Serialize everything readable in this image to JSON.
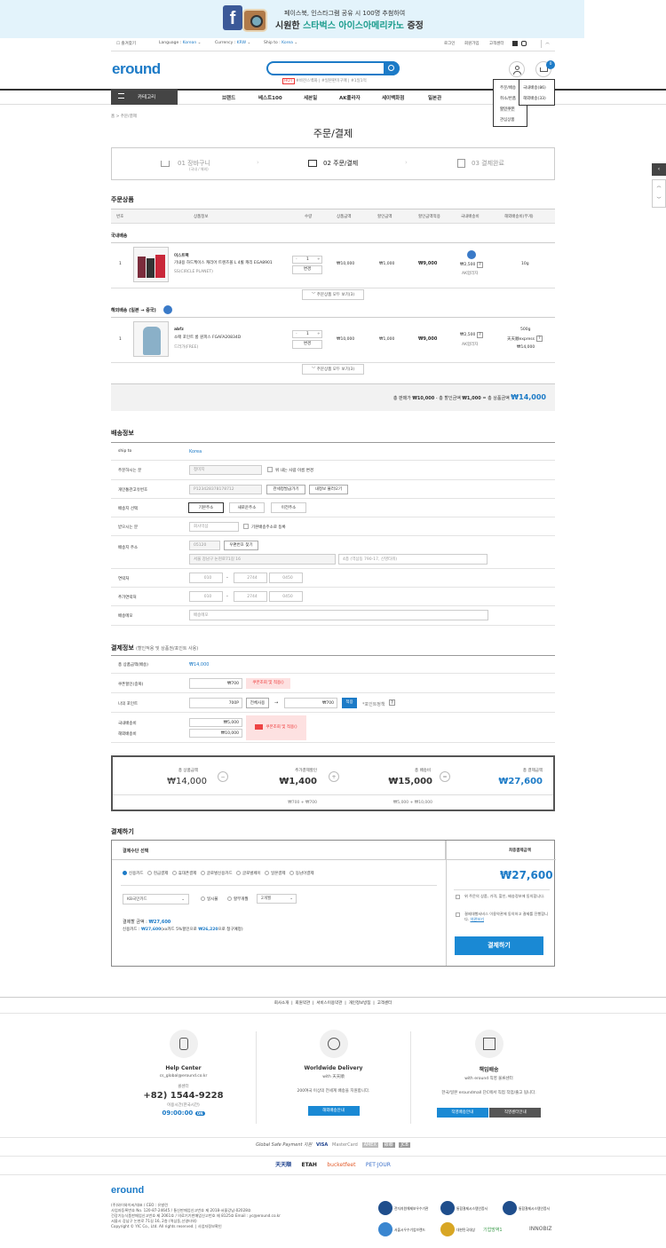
{
  "banner": {
    "line1": "페이스북, 인스타그램 공유 시 100명 추첨하여",
    "line2_pre": "시원한 ",
    "line2_highlight": "스타벅스 아이스아메리카노",
    "line2_post": " 증정"
  },
  "topbar": {
    "bookmark": "즐겨찾기",
    "language_label": "Language :",
    "language": "Korean",
    "currency_label": "Currency :",
    "currency": "KRW",
    "shipto_label": "Ship to :",
    "shipto": "Korea",
    "login": "로그인",
    "signup": "회원가입",
    "support": "고객센터"
  },
  "header": {
    "logo": "eround",
    "tags": [
      "HOT",
      "#바잔스백화",
      "#일본판미구매",
      "#1일1억"
    ],
    "cart_count": "0"
  },
  "nav": {
    "category": "카테고리",
    "items": [
      "브랜드",
      "베스트100",
      "세븐일",
      "AK플라자",
      "세이백화점",
      "일본관"
    ]
  },
  "dropdown": {
    "left": [
      "주문/배송",
      "취소/반품",
      "할인쿠폰",
      "관심상품"
    ],
    "right": [
      "국내배송(86)",
      "해외배송(33)"
    ]
  },
  "breadcrumb": "홈 > 주문/결제",
  "page_title": "주문/결제",
  "steps": [
    {
      "label": "01 장바구니",
      "sub": "(국내 / 해외)"
    },
    {
      "label": "02 주문/결제",
      "sub": ""
    },
    {
      "label": "03 결제완료",
      "sub": ""
    }
  ],
  "order": {
    "title": "주문상품",
    "headers": [
      "번호",
      "상품정보",
      "수량",
      "상품금액",
      "할인금액",
      "할인금액적용",
      "국내배송비",
      "해외배송비(무게)"
    ],
    "domestic_label": "국내배송",
    "overseas_label": "해외배송 (일본 → 중국)",
    "items": [
      {
        "no": "1",
        "brand": "이스트팩",
        "name": "기내용 하드케이스 캐리어 트렌즈볼 L 4휠 캐리 EGA8901",
        "option": "SS(CIRCLE PLANET)",
        "qty": "1",
        "change": "변경",
        "price": "₩10,000",
        "discount": "₩1,000",
        "final": "₩9,000",
        "ship": "₩2,500",
        "ship_note": "AK합리자",
        "weight": "10g"
      },
      {
        "no": "1",
        "brand": "abfz",
        "name": "소매 포인트 롱 원피스 FGAFA20834D",
        "option": "드러가(FREE)",
        "qty": "1",
        "change": "변경",
        "price": "₩10,000",
        "discount": "₩1,000",
        "final": "₩9,000",
        "ship": "₩2,500",
        "ship_note": "AK합리자",
        "weight": "500g",
        "weight_method": "天天顺express",
        "weight_price": "₩14,000"
      }
    ],
    "more": "주문상품 모두 보기(3)",
    "summary_pre": "총 판매가 ",
    "summary_v1": "₩10,000",
    "summary_mid": " - 총 할인금액 ",
    "summary_v2": "₩1,000",
    "summary_eq": " = 총 상품금액 ",
    "summary_total": "₩14,000"
  },
  "shipping": {
    "title": "배송정보",
    "rows": [
      {
        "label": "ship to",
        "value": "Korea"
      },
      {
        "label": "주문하시는 분",
        "value": "정미지",
        "check": "위 내는 사람 이름 변경"
      },
      {
        "label": "개인통관고유번호",
        "value": "P123428378178712",
        "btn1": "관세청발급가기",
        "btn2": "내정보 불러오기"
      },
      {
        "label": "배송지 선택",
        "opts": [
          "기본주소",
          "새로운주소",
          "이전주소"
        ]
      },
      {
        "label": "받으시는 분",
        "value": "회사먹삼",
        "check": "기본배송주소로 등록"
      },
      {
        "label": "배송지 주소",
        "zip": "05120",
        "zipbtn": "우편번호 찾기",
        "addr1": "서울 강남구 논현로71길 16",
        "addr2": "4층 (역삼동 790-17, 신영타워)"
      },
      {
        "label": "연락처",
        "p1": "010",
        "p2": "2744",
        "p3": "0450"
      },
      {
        "label": "추가연락처",
        "p1": "010",
        "p2": "2744",
        "p3": "0450"
      },
      {
        "label": "배송메모",
        "value": "배송메모"
      }
    ]
  },
  "payinfo": {
    "title": "결제정보",
    "subtitle": "(할인적용 및 상품권/포인트 사용)",
    "total_label": "총 상품금액(배송)",
    "total_value": "₩14,000",
    "coupon_label": "쿠폰할인(중복)",
    "coupon_value": "₩700",
    "coupon_note": "쿠폰조회 및 적용()",
    "point_label": "나의 포인트",
    "point_have": "700P",
    "point_btn": "전체사용",
    "point_use": "₩700",
    "point_apply": "적용",
    "point_note": "*포인트정책",
    "ship_domestic_label": "국내배송비",
    "ship_domestic": "₩5,000",
    "ship_overseas_label": "해외배송비",
    "ship_overseas": "₩10,000",
    "ship_note": "쿠폰조회 및 적용()"
  },
  "totals": [
    {
      "label": "총 상품금액",
      "value": "₩14,000",
      "sub": ""
    },
    {
      "label": "추가결제할인",
      "value": "₩1,400",
      "sub": "₩700 + ₩700"
    },
    {
      "label": "총 배송비",
      "value": "₩15,000",
      "sub": "₩5,000 + ₩10,000"
    },
    {
      "label": "총 결제금액",
      "value": "₩27,600",
      "sub": ""
    }
  ],
  "payment": {
    "title": "결제하기",
    "method_title": "결제수단 선택",
    "methods": [
      "신용카드",
      "현금결제",
      "휴대폰결제",
      "글로벌신용카드",
      "글로벌페이",
      "일본결제",
      "동남아결제"
    ],
    "card": "KB국민카드",
    "inst1": "일시불",
    "inst2": "할부개월",
    "months": "2개월",
    "amount_label": "결제할 금액 : ",
    "amount": "₩27,600",
    "card_line_pre": "신용카드 : ",
    "card_line_v": "₩27,600",
    "card_line_mid": "(xx카드 5%할인으로 ",
    "card_line_v2": "₩26,220",
    "card_line_post": "으로 청구예정)",
    "final_title": "최종결제금액",
    "final_amount": "₩27,600",
    "agree1": "위 주문의 상품, 가격, 할인, 배송정보에 동의합니다.",
    "agree2": "결제대행서비스 이용약관에 동의하고 결제를 진행합니다.",
    "agree2_link": "약관보기",
    "pay_button": "결제하기"
  },
  "footer": {
    "links": [
      "회사소개",
      "회원약관",
      "서비스이용약관",
      "개인정보방침",
      "고객센터"
    ],
    "help_title": "Help Center",
    "help_email": "cs_global@eround.co.kr",
    "help_sub": "콜센터",
    "help_phone": "+82) 1544-9228",
    "help_hours_label": "이용시간(한국시간)",
    "help_hours": "09:00:00",
    "help_on": "ON",
    "ww_title": "Worldwide Delivery",
    "ww_sub": "with 天天順",
    "ww_desc": "200여국 이상의 전세계 배송을 지원합니다.",
    "ww_btn": "해외배송안내",
    "resp_title": "책임배송",
    "resp_sub": "with eround 직영 물류센터",
    "resp_desc": "한국/일본 eroundmall 단C에서 직접 작업/출고 됩니다.",
    "resp_btn1": "직영배송안내",
    "resp_btn2": "직영센터안내",
    "safe_label": "Global Safe Payment 지원",
    "pay_logos": [
      "VISA",
      "MasterCard",
      "AMEX",
      "銀聯",
      "JCB"
    ],
    "partners": [
      "天天顺",
      "ETAH",
      "bucketfeet",
      "PET·JOUR"
    ],
    "logo": "eround",
    "company": [
      "(주)와이와이씨/대표 / CEO : 유발린",
      "사업자등록번호 No. 120-87-24645 / 통신판매업신고번호 제 2018-서울강남-02028호",
      "건강기능식품판매업신고번호 제 2061호 / 의료기기판매업신고번호 제 8125호 Email : yc@eround.co.kr",
      "서울시 강남구 논현로 71길 16, 2층 (역삼동,신영타워)",
      "Copyright © YIC Co., Ltd. All rights reserved. | 사업자정보확인"
    ],
    "certs": [
      "전자지원해제보우수기관",
      "통합결제시스템인증서",
      "통합결제시스템인증서",
      "서울시우수기업브랜드",
      "대한민국대상",
      "기업방역1",
      "INNOBIZ"
    ]
  },
  "colors": {
    "accent": "#1d7bc7",
    "pay_button": "#1a89d4",
    "highlight": "#1a9c8c"
  }
}
